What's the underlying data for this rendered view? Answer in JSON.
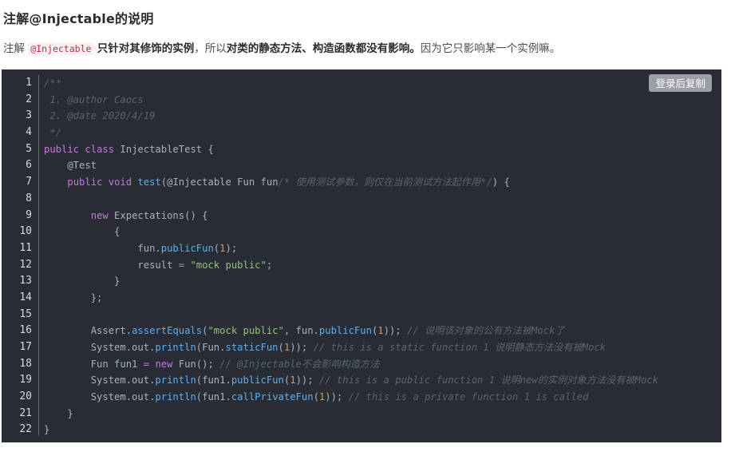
{
  "heading": "注解@Injectable的说明",
  "paragraph": {
    "prefix": "注解 ",
    "code": "@Injectable",
    "bold1": "只针对其修饰的实例",
    "mid": "，所以",
    "bold2": "对类的静态方法、构造函数都没有影响。",
    "suffix": "因为它只影响某一个实例嘛。"
  },
  "copy_button": "登录后复制",
  "line_numbers": [
    "1",
    "2",
    "3",
    "4",
    "5",
    "6",
    "7",
    "8",
    "9",
    "10",
    "11",
    "12",
    "13",
    "14",
    "15",
    "16",
    "17",
    "18",
    "19",
    "20",
    "21",
    "22"
  ],
  "code_lines": [
    [
      {
        "t": "/**",
        "c": "cmt"
      }
    ],
    [
      {
        "t": " 1. @author Caocs",
        "c": "cmt"
      }
    ],
    [
      {
        "t": " 2. @date 2020/4/19",
        "c": "cmt"
      }
    ],
    [
      {
        "t": " */",
        "c": "cmt"
      }
    ],
    [
      {
        "t": "public",
        "c": "kw"
      },
      {
        "t": " "
      },
      {
        "t": "class",
        "c": "kw"
      },
      {
        "t": " InjectableTest {"
      }
    ],
    [
      {
        "t": "    @Test"
      }
    ],
    [
      {
        "t": "    "
      },
      {
        "t": "public",
        "c": "kw"
      },
      {
        "t": " "
      },
      {
        "t": "void",
        "c": "kw"
      },
      {
        "t": " "
      },
      {
        "t": "test",
        "c": "fn"
      },
      {
        "t": "(@Injectable Fun fun"
      },
      {
        "t": "/* 使用测试参数，则仅在当前测试方法起作用*/",
        "c": "cmt"
      },
      {
        "t": ") {"
      }
    ],
    [
      {
        "t": ""
      }
    ],
    [
      {
        "t": "        "
      },
      {
        "t": "new",
        "c": "kw"
      },
      {
        "t": " Expectations() {"
      }
    ],
    [
      {
        "t": "            {"
      }
    ],
    [
      {
        "t": "                fun."
      },
      {
        "t": "publicFun",
        "c": "fn"
      },
      {
        "t": "("
      },
      {
        "t": "1",
        "c": "num"
      },
      {
        "t": ");"
      }
    ],
    [
      {
        "t": "                result "
      },
      {
        "t": "=",
        "c": "op"
      },
      {
        "t": " "
      },
      {
        "t": "\"mock public\"",
        "c": "str"
      },
      {
        "t": ";"
      }
    ],
    [
      {
        "t": "            }"
      }
    ],
    [
      {
        "t": "        };"
      }
    ],
    [
      {
        "t": ""
      }
    ],
    [
      {
        "t": "        Assert."
      },
      {
        "t": "assertEquals",
        "c": "fn"
      },
      {
        "t": "("
      },
      {
        "t": "\"mock public\"",
        "c": "str"
      },
      {
        "t": ", fun."
      },
      {
        "t": "publicFun",
        "c": "fn"
      },
      {
        "t": "("
      },
      {
        "t": "1",
        "c": "num"
      },
      {
        "t": ")); "
      },
      {
        "t": "// 说明该对象的公有方法被Mock了",
        "c": "cmt"
      }
    ],
    [
      {
        "t": "        System.out."
      },
      {
        "t": "println",
        "c": "fn"
      },
      {
        "t": "(Fun."
      },
      {
        "t": "staticFun",
        "c": "fn"
      },
      {
        "t": "("
      },
      {
        "t": "1",
        "c": "num"
      },
      {
        "t": ")); "
      },
      {
        "t": "// this is a static function 1 说明静态方法没有被Mock",
        "c": "cmt"
      }
    ],
    [
      {
        "t": "        Fun fun1 "
      },
      {
        "t": "=",
        "c": "op"
      },
      {
        "t": " "
      },
      {
        "t": "new",
        "c": "kw"
      },
      {
        "t": " Fun(); "
      },
      {
        "t": "// @Injectable不会影响构造方法",
        "c": "cmt"
      }
    ],
    [
      {
        "t": "        System.out."
      },
      {
        "t": "println",
        "c": "fn"
      },
      {
        "t": "(fun1."
      },
      {
        "t": "publicFun",
        "c": "fn"
      },
      {
        "t": "("
      },
      {
        "t": "1",
        "c": "num"
      },
      {
        "t": ")); "
      },
      {
        "t": "// this is a public function 1 说明new的实例对象方法没有被Mock",
        "c": "cmt"
      }
    ],
    [
      {
        "t": "        System.out."
      },
      {
        "t": "println",
        "c": "fn"
      },
      {
        "t": "(fun1."
      },
      {
        "t": "callPrivateFun",
        "c": "fn"
      },
      {
        "t": "("
      },
      {
        "t": "1",
        "c": "num"
      },
      {
        "t": ")); "
      },
      {
        "t": "// this is a private function 1 is called",
        "c": "cmt"
      }
    ],
    [
      {
        "t": "    }"
      }
    ],
    [
      {
        "t": "}"
      }
    ]
  ]
}
